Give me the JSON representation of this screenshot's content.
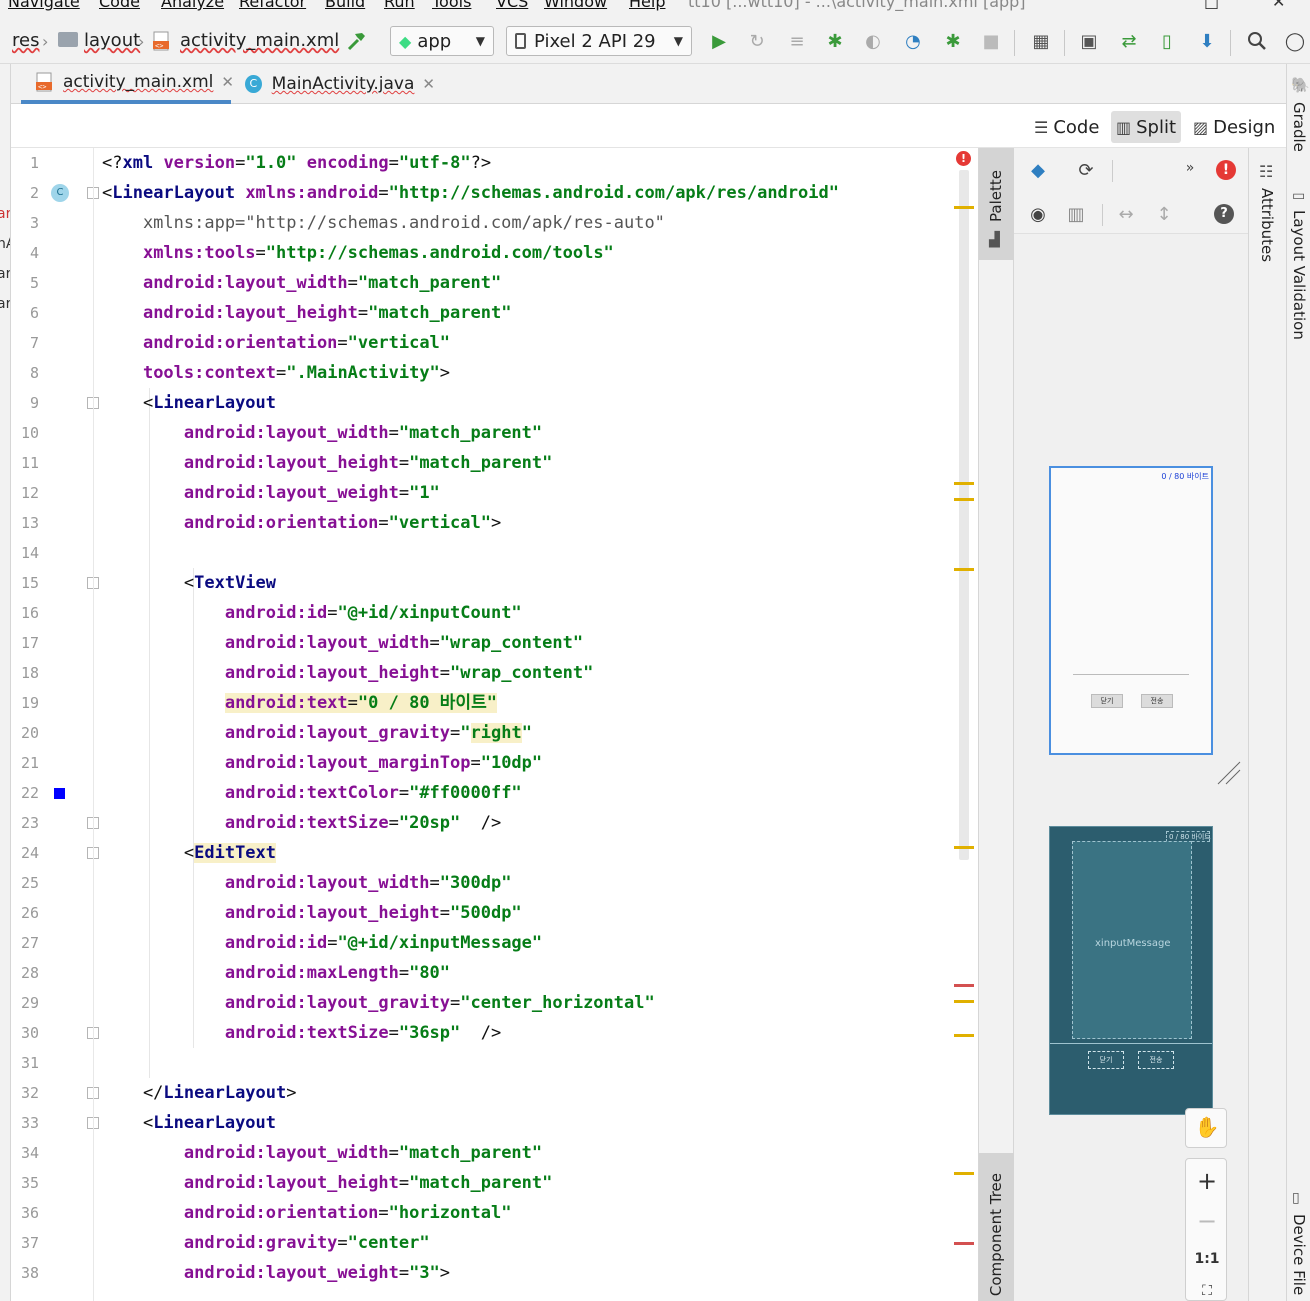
{
  "menu": {
    "items": [
      "Navigate",
      "Code",
      "Analyze",
      "Refactor",
      "Build",
      "Run",
      "Tools",
      "VCS",
      "Window",
      "Help"
    ],
    "window_title": "tt10 [...wtt10] - ...\\activity_main.xml [app]"
  },
  "breadcrumb": [
    "res",
    "layout",
    "activity_main.xml"
  ],
  "run_config": {
    "module": "app",
    "device": "Pixel 2 API 29"
  },
  "tabs": [
    {
      "label": "activity_main.xml",
      "active": true
    },
    {
      "label": "MainActivity.java",
      "active": false
    }
  ],
  "view_modes": {
    "code": "Code",
    "split": "Split",
    "design": "Design",
    "selected": "Split"
  },
  "side_panels": {
    "palette": "Palette",
    "component_tree": "Component Tree",
    "attributes": "Attributes",
    "gradle": "Gradle",
    "layout_validation": "Layout Validation",
    "device_file": "Device File"
  },
  "editor": {
    "line_numbers": [
      "1",
      "2",
      "3",
      "4",
      "5",
      "6",
      "7",
      "8",
      "9",
      "10",
      "11",
      "12",
      "13",
      "14",
      "15",
      "16",
      "17",
      "18",
      "19",
      "20",
      "21",
      "22",
      "23",
      "24",
      "25",
      "26",
      "27",
      "28",
      "29",
      "30",
      "31",
      "32",
      "33",
      "34",
      "35",
      "36",
      "37",
      "38"
    ],
    "lines": [
      [
        {
          "t": "<?",
          "c": "plain"
        },
        {
          "t": "xml ",
          "c": "tag"
        },
        {
          "t": "version",
          "c": "attr"
        },
        {
          "t": "=",
          "c": "plain"
        },
        {
          "t": "\"1.0\"",
          "c": "val"
        },
        {
          "t": " ",
          "c": "plain"
        },
        {
          "t": "encoding",
          "c": "attr"
        },
        {
          "t": "=",
          "c": "plain"
        },
        {
          "t": "\"utf-8\"",
          "c": "val"
        },
        {
          "t": "?>",
          "c": "plain"
        }
      ],
      [
        {
          "t": "<",
          "c": "plain"
        },
        {
          "t": "LinearLayout ",
          "c": "tag"
        },
        {
          "t": "xmlns:android",
          "c": "attr"
        },
        {
          "t": "=",
          "c": "plain"
        },
        {
          "t": "\"http://schemas.android.com/apk/res/android\"",
          "c": "val"
        }
      ],
      [
        {
          "t": "    xmlns:app=\"http://schemas.android.com/apk/res-auto\"",
          "c": "grey"
        }
      ],
      [
        {
          "t": "    ",
          "c": "plain"
        },
        {
          "t": "xmlns:tools",
          "c": "attr"
        },
        {
          "t": "=",
          "c": "plain"
        },
        {
          "t": "\"http://schemas.android.com/tools\"",
          "c": "val"
        }
      ],
      [
        {
          "t": "    ",
          "c": "plain"
        },
        {
          "t": "android:layout_width",
          "c": "attr"
        },
        {
          "t": "=",
          "c": "plain"
        },
        {
          "t": "\"match_parent\"",
          "c": "val"
        }
      ],
      [
        {
          "t": "    ",
          "c": "plain"
        },
        {
          "t": "android:layout_height",
          "c": "attr"
        },
        {
          "t": "=",
          "c": "plain"
        },
        {
          "t": "\"match_parent\"",
          "c": "val"
        }
      ],
      [
        {
          "t": "    ",
          "c": "plain"
        },
        {
          "t": "android:orientation",
          "c": "attr"
        },
        {
          "t": "=",
          "c": "plain"
        },
        {
          "t": "\"vertical\"",
          "c": "val"
        }
      ],
      [
        {
          "t": "    ",
          "c": "plain"
        },
        {
          "t": "tools:context",
          "c": "attr"
        },
        {
          "t": "=",
          "c": "plain"
        },
        {
          "t": "\".MainActivity\"",
          "c": "val"
        },
        {
          "t": ">",
          "c": "plain"
        }
      ],
      [
        {
          "t": "    <",
          "c": "plain"
        },
        {
          "t": "LinearLayout",
          "c": "tag"
        }
      ],
      [
        {
          "t": "        ",
          "c": "plain"
        },
        {
          "t": "android:layout_width",
          "c": "attr"
        },
        {
          "t": "=",
          "c": "plain"
        },
        {
          "t": "\"match_parent\"",
          "c": "val"
        }
      ],
      [
        {
          "t": "        ",
          "c": "plain"
        },
        {
          "t": "android:layout_height",
          "c": "attr"
        },
        {
          "t": "=",
          "c": "plain"
        },
        {
          "t": "\"match_parent\"",
          "c": "val"
        }
      ],
      [
        {
          "t": "        ",
          "c": "plain"
        },
        {
          "t": "android:layout_weight",
          "c": "attr"
        },
        {
          "t": "=",
          "c": "plain"
        },
        {
          "t": "\"1\"",
          "c": "val"
        }
      ],
      [
        {
          "t": "        ",
          "c": "plain"
        },
        {
          "t": "android:orientation",
          "c": "attr"
        },
        {
          "t": "=",
          "c": "plain"
        },
        {
          "t": "\"vertical\"",
          "c": "val"
        },
        {
          "t": ">",
          "c": "plain"
        }
      ],
      [
        {
          "t": "",
          "c": "plain"
        }
      ],
      [
        {
          "t": "        <",
          "c": "plain"
        },
        {
          "t": "TextView",
          "c": "tag"
        }
      ],
      [
        {
          "t": "            ",
          "c": "plain"
        },
        {
          "t": "android:id",
          "c": "attr"
        },
        {
          "t": "=",
          "c": "plain"
        },
        {
          "t": "\"@+id/xinputCount\"",
          "c": "val"
        }
      ],
      [
        {
          "t": "            ",
          "c": "plain"
        },
        {
          "t": "android:layout_width",
          "c": "attr"
        },
        {
          "t": "=",
          "c": "plain"
        },
        {
          "t": "\"wrap_content\"",
          "c": "val"
        }
      ],
      [
        {
          "t": "            ",
          "c": "plain"
        },
        {
          "t": "android:layout_height",
          "c": "attr"
        },
        {
          "t": "=",
          "c": "plain"
        },
        {
          "t": "\"wrap_content\"",
          "c": "val"
        }
      ],
      [
        {
          "t": "            ",
          "c": "plain"
        },
        {
          "t": "android:text",
          "c": "attr hl"
        },
        {
          "t": "=",
          "c": "plain hl"
        },
        {
          "t": "\"0 / 80 바이트\"",
          "c": "val hl"
        }
      ],
      [
        {
          "t": "            ",
          "c": "plain"
        },
        {
          "t": "android:layout_gravity",
          "c": "attr"
        },
        {
          "t": "=",
          "c": "plain"
        },
        {
          "t": "\"",
          "c": "val"
        },
        {
          "t": "right",
          "c": "val hl"
        },
        {
          "t": "\"",
          "c": "val"
        }
      ],
      [
        {
          "t": "            ",
          "c": "plain"
        },
        {
          "t": "android:layout_marginTop",
          "c": "attr"
        },
        {
          "t": "=",
          "c": "plain"
        },
        {
          "t": "\"10dp\"",
          "c": "val"
        }
      ],
      [
        {
          "t": "            ",
          "c": "plain"
        },
        {
          "t": "android:textColor",
          "c": "attr"
        },
        {
          "t": "=",
          "c": "plain"
        },
        {
          "t": "\"#ff0000ff\"",
          "c": "val"
        }
      ],
      [
        {
          "t": "            ",
          "c": "plain"
        },
        {
          "t": "android:textSize",
          "c": "attr"
        },
        {
          "t": "=",
          "c": "plain"
        },
        {
          "t": "\"20sp\"",
          "c": "val"
        },
        {
          "t": "  />",
          "c": "plain"
        }
      ],
      [
        {
          "t": "        <",
          "c": "plain"
        },
        {
          "t": "EditText",
          "c": "tag hl"
        }
      ],
      [
        {
          "t": "            ",
          "c": "plain"
        },
        {
          "t": "android:layout_width",
          "c": "attr"
        },
        {
          "t": "=",
          "c": "plain"
        },
        {
          "t": "\"300dp\"",
          "c": "val"
        }
      ],
      [
        {
          "t": "            ",
          "c": "plain"
        },
        {
          "t": "android:layout_height",
          "c": "attr"
        },
        {
          "t": "=",
          "c": "plain"
        },
        {
          "t": "\"500dp\"",
          "c": "val"
        }
      ],
      [
        {
          "t": "            ",
          "c": "plain"
        },
        {
          "t": "android:id",
          "c": "attr"
        },
        {
          "t": "=",
          "c": "plain"
        },
        {
          "t": "\"@+id/xinputMessage\"",
          "c": "val"
        }
      ],
      [
        {
          "t": "            ",
          "c": "plain"
        },
        {
          "t": "android:maxLength",
          "c": "attr"
        },
        {
          "t": "=",
          "c": "plain"
        },
        {
          "t": "\"80\"",
          "c": "val"
        }
      ],
      [
        {
          "t": "            ",
          "c": "plain"
        },
        {
          "t": "android:layout_gravity",
          "c": "attr"
        },
        {
          "t": "=",
          "c": "plain"
        },
        {
          "t": "\"center_horizontal\"",
          "c": "val"
        }
      ],
      [
        {
          "t": "            ",
          "c": "plain"
        },
        {
          "t": "android:textSize",
          "c": "attr"
        },
        {
          "t": "=",
          "c": "plain"
        },
        {
          "t": "\"36sp\"",
          "c": "val"
        },
        {
          "t": "  />",
          "c": "plain"
        }
      ],
      [
        {
          "t": "",
          "c": "plain"
        }
      ],
      [
        {
          "t": "    </",
          "c": "plain"
        },
        {
          "t": "LinearLayout",
          "c": "tag"
        },
        {
          "t": ">",
          "c": "plain"
        }
      ],
      [
        {
          "t": "    <",
          "c": "plain"
        },
        {
          "t": "LinearLayout",
          "c": "tag"
        }
      ],
      [
        {
          "t": "        ",
          "c": "plain"
        },
        {
          "t": "android:layout_width",
          "c": "attr"
        },
        {
          "t": "=",
          "c": "plain"
        },
        {
          "t": "\"match_parent\"",
          "c": "val"
        }
      ],
      [
        {
          "t": "        ",
          "c": "plain"
        },
        {
          "t": "android:layout_height",
          "c": "attr"
        },
        {
          "t": "=",
          "c": "plain"
        },
        {
          "t": "\"match_parent\"",
          "c": "val"
        }
      ],
      [
        {
          "t": "        ",
          "c": "plain"
        },
        {
          "t": "android:orientation",
          "c": "attr"
        },
        {
          "t": "=",
          "c": "plain"
        },
        {
          "t": "\"horizontal\"",
          "c": "val"
        }
      ],
      [
        {
          "t": "        ",
          "c": "plain"
        },
        {
          "t": "android:gravity",
          "c": "attr"
        },
        {
          "t": "=",
          "c": "plain"
        },
        {
          "t": "\"center\"",
          "c": "val"
        }
      ],
      [
        {
          "t": "        ",
          "c": "plain"
        },
        {
          "t": "android:layout_weight",
          "c": "attr"
        },
        {
          "t": "=",
          "c": "plain"
        },
        {
          "t": "\"3\"",
          "c": "val"
        },
        {
          "t": ">",
          "c": "plain"
        }
      ]
    ]
  },
  "preview": {
    "count_text": "0 / 80 바이트",
    "close_button": "닫기",
    "send_button": "전송",
    "blueprint_label": "xinputMessage",
    "zoom_actual": "1:1"
  },
  "colors": {
    "accent": "#4a88c7",
    "error": "#e53935",
    "tag": "#0a0a80",
    "attribute": "#871094",
    "value": "#067d17",
    "blueprint": "#2c5d6e"
  }
}
